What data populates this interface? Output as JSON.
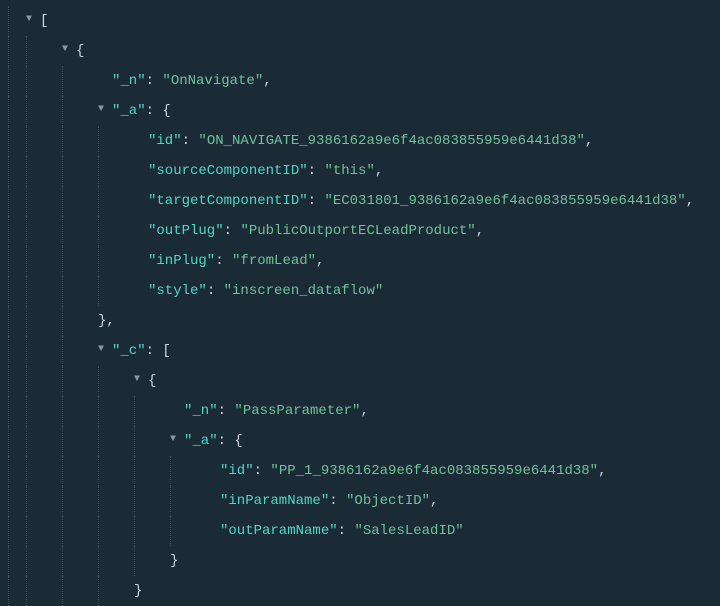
{
  "tri": "▼",
  "lines": [
    {
      "indent": 0,
      "tri": true,
      "open": "["
    },
    {
      "indent": 1,
      "tri": true,
      "open": "{"
    },
    {
      "indent": 2,
      "key": "_n",
      "val": "OnNavigate",
      "comma": true
    },
    {
      "indent": 2,
      "tri": true,
      "key": "_a",
      "open": "{"
    },
    {
      "indent": 3,
      "key": "id",
      "val": "ON_NAVIGATE_9386162a9e6f4ac083855959e6441d38",
      "comma": true
    },
    {
      "indent": 3,
      "key": "sourceComponentID",
      "val": "this",
      "comma": true
    },
    {
      "indent": 3,
      "key": "targetComponentID",
      "val": "EC031801_9386162a9e6f4ac083855959e6441d38",
      "comma": true
    },
    {
      "indent": 3,
      "key": "outPlug",
      "val": "PublicOutportECLeadProduct",
      "comma": true
    },
    {
      "indent": 3,
      "key": "inPlug",
      "val": "fromLead",
      "comma": true
    },
    {
      "indent": 3,
      "key": "style",
      "val": "inscreen_dataflow"
    },
    {
      "indent": 2,
      "close": "},",
      "closeIndent": 2
    },
    {
      "indent": 2,
      "tri": true,
      "key": "_c",
      "open": "["
    },
    {
      "indent": 3,
      "tri": true,
      "open": "{"
    },
    {
      "indent": 4,
      "key": "_n",
      "val": "PassParameter",
      "comma": true
    },
    {
      "indent": 4,
      "tri": true,
      "key": "_a",
      "open": "{"
    },
    {
      "indent": 5,
      "key": "id",
      "val": "PP_1_9386162a9e6f4ac083855959e6441d38",
      "comma": true
    },
    {
      "indent": 5,
      "key": "inParamName",
      "val": "ObjectID",
      "comma": true
    },
    {
      "indent": 5,
      "key": "outParamName",
      "val": "SalesLeadID"
    },
    {
      "indent": 4,
      "close": "}",
      "closeIndent": 4
    },
    {
      "indent": 3,
      "close": "}",
      "closeIndent": 3
    }
  ]
}
